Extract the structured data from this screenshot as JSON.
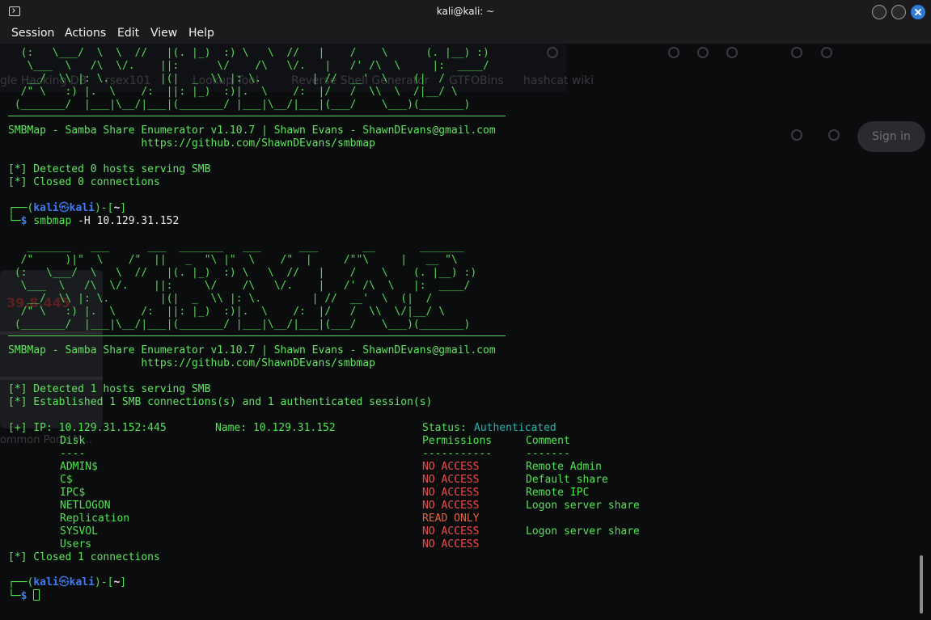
{
  "window": {
    "title": "kali@kali: ~"
  },
  "menu": [
    "Session",
    "Actions",
    "Edit",
    "View",
    "Help"
  ],
  "ghost_browser": {
    "bookmarks": [
      "gle Hacking DB",
      "rsex101",
      "Lookup Tool",
      "Reverse Shell Generator",
      "GTFOBins",
      "hashcat wiki"
    ],
    "sign_in": "Sign in",
    "card_value": "39.8.445",
    "card_caption": "ommon Ports M..."
  },
  "banner_art_top": [
    "  (:   \\___/  \\  \\  //   |(. |_)  :) \\   \\  //   |    /    \\      (. |__) :)",
    "   \\___  \\   /\\  \\/.    ||:      \\/    /\\   \\/.   |   /' /\\  \\     |:  ____/",
    "   __/  \\\\ |: \\.        |(|  _  \\\\ |: \\.        | //  __'  \\    (|  /",
    "  /\" \\   :) |.  \\    /:  ||: |_)  :)|.  \\    /:  |/   /  \\\\  \\  /|__/ \\",
    " (_______/  |___|\\__/|___|(_______/ |___|\\__/|___|(___/    \\___)(_______)"
  ],
  "banner_art_full": [
    "   _______   ___      ___  _______   ___      ___       __       _______",
    "  /\"     )|\"  \\    /\"  ||   _  \"\\ |\"  \\    /\"  |     /\"\"\\     |   __ \"\\",
    " (:   \\___/  \\   \\  //   |(. |_)  :) \\   \\  //   |    /    \\    (. |__) :)",
    "  \\___  \\   /\\  \\/.    ||:     \\/    /\\   \\/.    |   /' /\\  \\   |:  ____/",
    "   __/  \\\\ |: \\.        |(|  _  \\\\ |: \\.        | //  __'  \\  (|  /",
    "  /\" \\   :) |.  \\    /:  ||: |_)  :)|.  \\    /:  |/   /  \\\\  \\/|__/ \\",
    " (_______/  |___|\\__/|___|(_______/ |___|\\__/|___|(___/    \\___)(_______)"
  ],
  "smbmap_header": {
    "line1": "SMBMap - Samba Share Enumerator v1.10.7 | Shawn Evans - ShawnDEvans@gmail.com",
    "line2": "                     https://github.com/ShawnDEvans/smbmap"
  },
  "run1": {
    "lines": [
      "[*] Detected 0 hosts serving SMB",
      "[*] Closed 0 connections"
    ]
  },
  "prompt": {
    "open": "┌──(",
    "user": "kali",
    "at": "㉿",
    "host": "kali",
    "mid": ")-[",
    "dir": "~",
    "close": "]",
    "corner": "└─",
    "dollar": "$"
  },
  "command": {
    "name": "smbmap",
    "args": "-H 10.129.31.152"
  },
  "run2": {
    "lines": [
      "[*] Detected 1 hosts serving SMB",
      "[*] Established 1 SMB connections(s) and 1 authenticated session(s)"
    ],
    "ip_line": "[+] IP: 10.129.31.152:445",
    "name_line": "Name: 10.129.31.152",
    "status_label": "Status:",
    "status_value": "Authenticated",
    "headers": {
      "disk": "Disk",
      "permissions": "Permissions",
      "comment": "Comment",
      "disk_rule": "----",
      "perm_rule": "-----------",
      "comment_rule": "-------"
    },
    "shares": [
      {
        "disk": "ADMIN$",
        "perm": "NO ACCESS",
        "comment": "Remote Admin"
      },
      {
        "disk": "C$",
        "perm": "NO ACCESS",
        "comment": "Default share"
      },
      {
        "disk": "IPC$",
        "perm": "NO ACCESS",
        "comment": "Remote IPC"
      },
      {
        "disk": "NETLOGON",
        "perm": "NO ACCESS",
        "comment": "Logon server share"
      },
      {
        "disk": "Replication",
        "perm": "READ ONLY",
        "comment": ""
      },
      {
        "disk": "SYSVOL",
        "perm": "NO ACCESS",
        "comment": "Logon server share"
      },
      {
        "disk": "Users",
        "perm": "NO ACCESS",
        "comment": ""
      }
    ],
    "closing": "[*] Closed 1 connections"
  },
  "colors": {
    "green": "#4fe64f",
    "blue": "#3c7cf0",
    "red": "#f04b4b",
    "orange": "#e8643c",
    "teal": "#27b5a8",
    "background": "#0b0c0e"
  }
}
